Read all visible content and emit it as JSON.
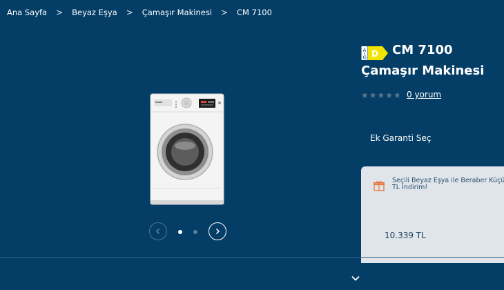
{
  "breadcrumb": {
    "items": [
      "Ana Sayfa",
      "Beyaz Eşya",
      "Çamaşır Makinesi",
      "CM 7100"
    ],
    "separator": ">"
  },
  "gallery": {
    "image_alt": "washing-machine-image",
    "slide_count": 2,
    "active_slide": 1
  },
  "product": {
    "energy_class_range": [
      "A",
      "G"
    ],
    "energy_class": "D",
    "energy_color": "#f1e400",
    "title_line1": "CM 7100",
    "title_line2": "Çamaşır Makinesi",
    "rating_stars": "★★★★★",
    "rating_value": 0,
    "reviews_link": "0 yorum"
  },
  "warranty": {
    "label": "Ek Garanti Seç"
  },
  "promo": {
    "icon": "gift-icon",
    "text": "Seçili Beyaz Eşya ile Beraber Küçük TL İndirim!",
    "price": "10.339 TL"
  },
  "icons": {
    "prev": "chevron-left-icon",
    "next": "chevron-right-icon",
    "expand": "chevron-down-icon"
  },
  "colors": {
    "background": "#043e66",
    "card": "#dfe5ea",
    "accent_orange": "#e8753a"
  }
}
